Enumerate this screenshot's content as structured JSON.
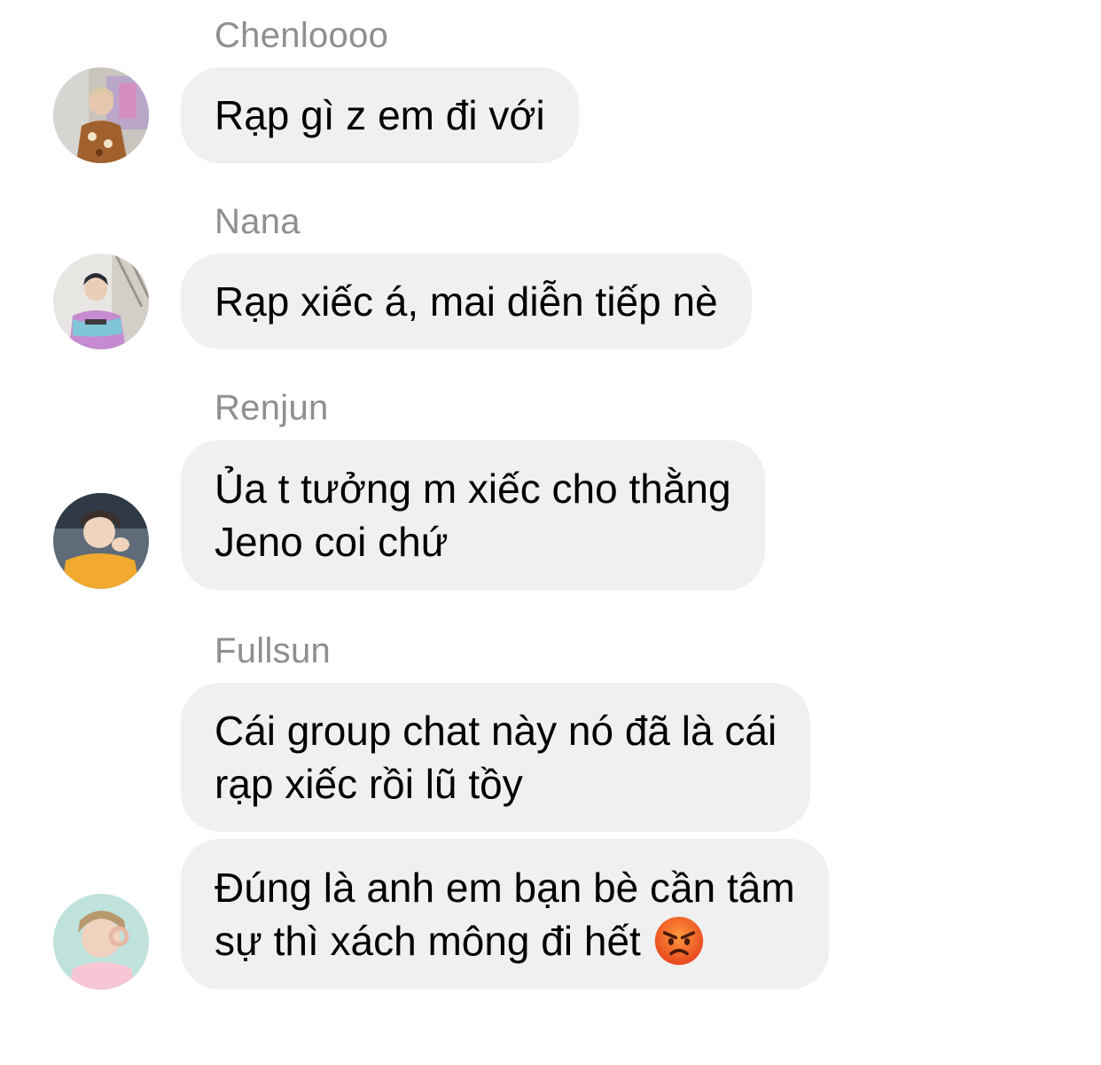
{
  "messages": [
    {
      "sender": "Chenloooo",
      "text": "Rạp gì z em đi với",
      "avatar_icon": "user-avatar-icon"
    },
    {
      "sender": "Nana",
      "text": "Rạp xiếc á, mai diễn tiếp nè",
      "avatar_icon": "user-avatar-icon"
    },
    {
      "sender": "Renjun",
      "text": "Ủa t tưởng m xiếc cho thằng\nJeno coi chứ",
      "avatar_icon": "user-avatar-icon"
    },
    {
      "sender": "Fullsun",
      "text": "Cái group chat này nó đã là cái\nrạp xiếc rồi lũ tồy",
      "avatar_icon": "user-avatar-icon"
    },
    {
      "text": "Đúng là anh em bạn bè cần tâm\nsự thì xách mông đi hết",
      "emoji": "angry-face-icon",
      "avatar_icon": "user-avatar-icon"
    }
  ],
  "colors": {
    "bubble": "#f0f0f0",
    "sender_name": "#8e8e93",
    "text": "#000000",
    "background": "#ffffff"
  }
}
